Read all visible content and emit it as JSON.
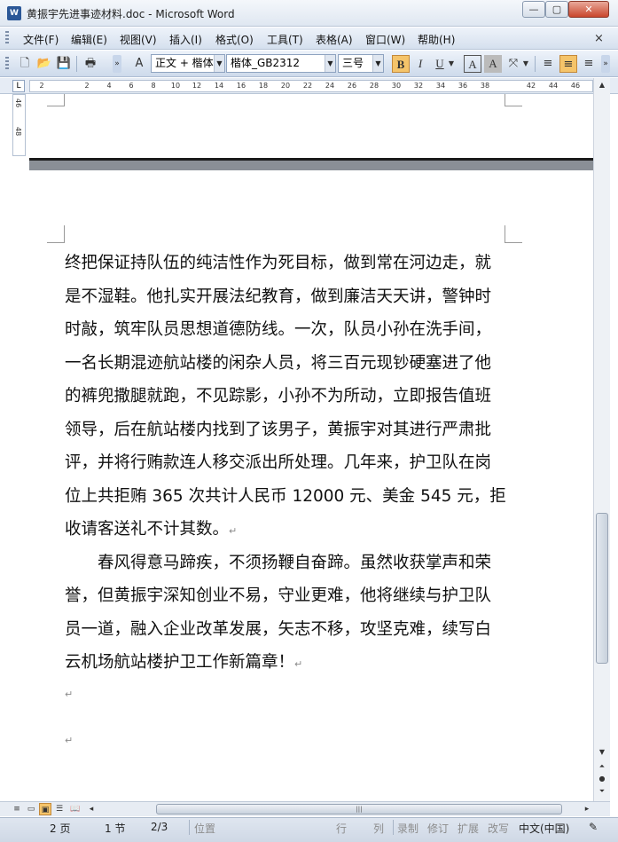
{
  "window": {
    "title": "黄振宇先进事迹材料.doc - Microsoft Word",
    "icon": "word-doc-icon",
    "controls": {
      "minimize": "—",
      "maximize": "▢",
      "close": "✕"
    }
  },
  "menu": {
    "items": [
      "文件(F)",
      "编辑(E)",
      "视图(V)",
      "插入(I)",
      "格式(O)",
      "工具(T)",
      "表格(A)",
      "窗口(W)",
      "帮助(H)"
    ],
    "close_doc": "×"
  },
  "toolbar": {
    "style_value": "正文 + 楷体",
    "font_value": "楷体_GB2312",
    "size_value": "三号",
    "bold": "B",
    "italic": "I",
    "underline": "U",
    "char_border": "A",
    "char_shading": "A",
    "bold_active": true,
    "align_center_active": true
  },
  "ruler": {
    "ticks": [
      "2",
      "2",
      "4",
      "6",
      "8",
      "10",
      "12",
      "14",
      "16",
      "18",
      "20",
      "22",
      "24",
      "26",
      "28",
      "30",
      "32",
      "34",
      "36",
      "38",
      "42",
      "44",
      "46"
    ],
    "corner_label": "L",
    "vertical_ticks": [
      "46",
      "48"
    ]
  },
  "document": {
    "paragraph1_lines": [
      "终把保证持队伍的纯洁性作为死目标，做到常在河边走，就",
      "是不湿鞋。他扎实开展法纪教育，做到廉洁天天讲，警钟时",
      "时敲，筑牢队员思想道德防线。一次，队员小孙在洗手间，",
      "一名长期混迹航站楼的闲杂人员，将三百元现钞硬塞进了他",
      "的裤兜撒腿就跑，不见踪影，小孙不为所动，立即报告值班",
      "领导，后在航站楼内找到了该男子，黄振宇对其进行严肃批",
      "评，并将行贿款连人移交派出所处理。几年来，护卫队在岗",
      "位上共拒贿 365 次共计人民币 12000 元、美金 545 元，拒",
      "收请客送礼不计其数。"
    ],
    "paragraph2_lines": [
      "　　春风得意马蹄疾，不须扬鞭自奋蹄。虽然收获掌声和荣",
      "誉，但黄振宇深知创业不易，守业更难，他将继续与护卫队",
      "员一道，融入企业改革发展，矢志不移，攻坚克难，续写白",
      "云机场航站楼护卫工作新篇章！"
    ],
    "para_mark": "↵"
  },
  "status": {
    "page": "2 页",
    "section": "1 节",
    "page_of": "2/3",
    "position": "位置",
    "line": "行",
    "column": "列",
    "rec": "录制",
    "trk": "修订",
    "ext": "扩展",
    "ovr": "改写",
    "language": "中文(中国)"
  }
}
